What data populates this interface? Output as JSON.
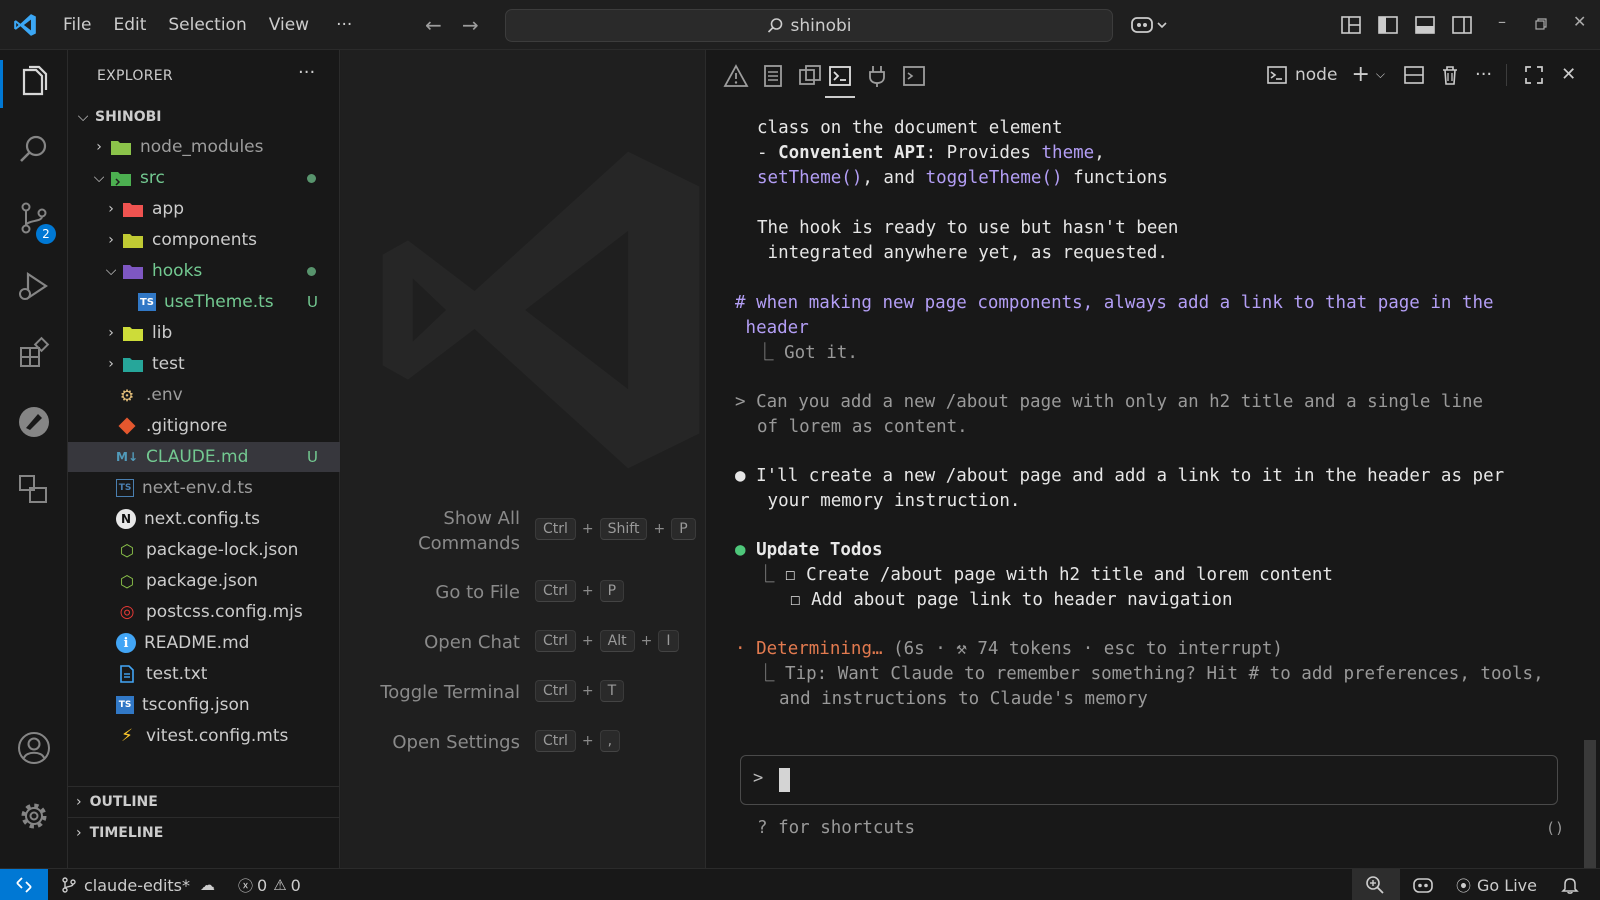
{
  "titlebar": {
    "menu": [
      "File",
      "Edit",
      "Selection",
      "View"
    ],
    "more": "···",
    "search_text": "shinobi"
  },
  "activitybar": {
    "source_control_badge": "2"
  },
  "explorer": {
    "title": "EXPLORER",
    "root": "SHINOBI",
    "items": [
      {
        "label": "node_modules"
      },
      {
        "label": "src"
      },
      {
        "label": "app"
      },
      {
        "label": "components"
      },
      {
        "label": "hooks"
      },
      {
        "label": "useTheme.ts",
        "status": "U"
      },
      {
        "label": "lib"
      },
      {
        "label": "test"
      },
      {
        "label": ".env"
      },
      {
        "label": ".gitignore"
      },
      {
        "label": "CLAUDE.md",
        "status": "U"
      },
      {
        "label": "next-env.d.ts"
      },
      {
        "label": "next.config.ts"
      },
      {
        "label": "package-lock.json"
      },
      {
        "label": "package.json"
      },
      {
        "label": "postcss.config.mjs"
      },
      {
        "label": "README.md"
      },
      {
        "label": "test.txt"
      },
      {
        "label": "tsconfig.json"
      },
      {
        "label": "vitest.config.mts"
      }
    ],
    "outline": "OUTLINE",
    "timeline": "TIMELINE"
  },
  "editor": {
    "shortcuts": [
      {
        "label": "Show All",
        "label2": "Commands",
        "keys": [
          "Ctrl",
          "Shift",
          "P"
        ]
      },
      {
        "label": "Go to File",
        "keys": [
          "Ctrl",
          "P"
        ]
      },
      {
        "label": "Open Chat",
        "keys": [
          "Ctrl",
          "Alt",
          "I"
        ]
      },
      {
        "label": "Toggle Terminal",
        "keys": [
          "Ctrl",
          "T"
        ]
      },
      {
        "label": "Open Settings",
        "keys": [
          "Ctrl",
          ","
        ]
      }
    ]
  },
  "panel": {
    "terminal_name": "node",
    "terminal": {
      "l1": "class on the document element",
      "l2_dash": "- ",
      "l2_bold": "Convenient API",
      "l2_rest": ": Provides ",
      "l2_theme": "theme",
      "l2_comma": ",",
      "l3_set": "setTheme()",
      "l3_and": ", and ",
      "l3_toggle": "toggleTheme()",
      "l3_rest": " functions",
      "l4": "The hook is ready to use but hasn't been",
      "l5": " integrated anywhere yet, as requested.",
      "l6": "# when making new page components, always add a link to that page in the",
      "l7": " header",
      "l8": "  ⎿ Got it.",
      "l9_arrow": ">",
      "l9": "Can you add a new /about page with only an h2 title and a single line",
      "l10": "of lorem as content.",
      "l11_bullet": "●",
      "l11": "I'll create a new /about page and add a link to it in the header as per",
      "l12": " your memory instruction.",
      "l13_bullet": "●",
      "l13": "Update Todos",
      "l14_corner": "⎿ ",
      "l14": "☐ Create /about page with h2 title and lorem content",
      "l15": "☐ Add about page link to header navigation",
      "l16_bullet": "·",
      "l16_status": "Determining…",
      "l16_rest": " (6s · ⚒ 74 tokens · esc to interrupt)",
      "l17": "⎿ Tip: Want Claude to remember something? Hit # to add preferences, tools,",
      "l18": "and instructions to Claude's memory",
      "prompt_caret": ">",
      "hint": "? for shortcuts",
      "hint_right": "()"
    }
  },
  "statusbar": {
    "branch": "claude-edits*",
    "errors": "0",
    "warnings": "0",
    "golive": "Go Live"
  }
}
